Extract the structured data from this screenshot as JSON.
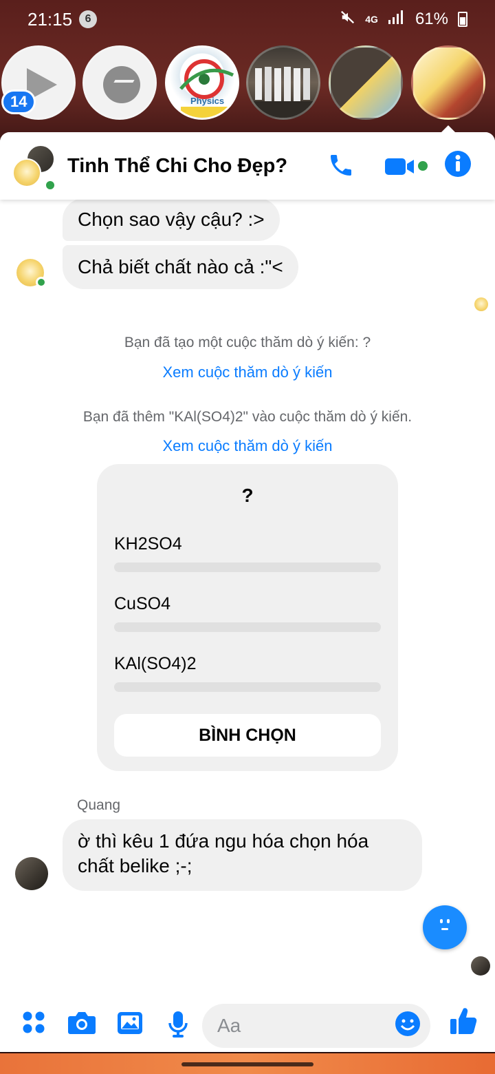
{
  "status_bar": {
    "time": "21:15",
    "notification_count": "6",
    "network": "4G",
    "battery": "61%"
  },
  "chat_heads": {
    "badge": "14",
    "physics_label": "Physics"
  },
  "header": {
    "title": "Tinh Thể Chi Cho Đẹp?"
  },
  "messages": {
    "m1": "Chọn sao vậy cậu? :>",
    "m2": "Chả biết chất nào cả :\"<",
    "sys1": "Bạn đã tạo một cuộc thăm dò ý kiến: ?",
    "link1": "Xem cuộc thăm dò ý kiến",
    "sys2": "Bạn đã thêm \"KAl(SO4)2\" vào cuộc thăm dò ý kiến.",
    "link2": "Xem cuộc thăm dò ý kiến",
    "sender": "Quang",
    "m3": "ờ thì kêu 1 đứa ngu hóa chọn hóa chất belike ;-;"
  },
  "poll": {
    "question": "?",
    "options": [
      "KH2SO4",
      "CuSO4",
      "KAl(SO4)2"
    ],
    "vote_label": "BÌNH CHỌN"
  },
  "composer": {
    "placeholder": "Aa"
  },
  "colors": {
    "accent": "#0a7cff",
    "online": "#31a24c",
    "bubble": "#f0f0f0"
  }
}
